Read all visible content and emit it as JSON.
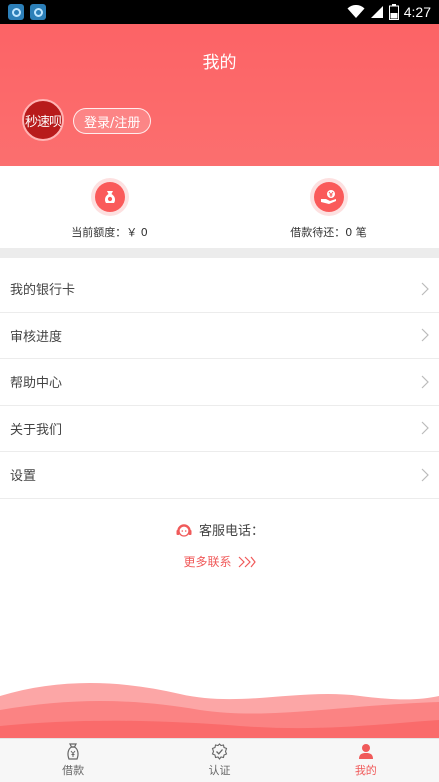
{
  "status_bar": {
    "time": "4:27",
    "battery": "2"
  },
  "header": {
    "title": "我的",
    "avatar_text": "秒速呗",
    "login_label": "登录/注册"
  },
  "stats": [
    {
      "icon": "money-bag-icon",
      "text": "当前额度：￥ 0"
    },
    {
      "icon": "repay-hand-icon",
      "text": "借款待还：0 笔"
    }
  ],
  "menu": [
    {
      "label": "我的银行卡"
    },
    {
      "label": "审核进度"
    },
    {
      "label": "帮助中心"
    },
    {
      "label": "关于我们"
    },
    {
      "label": "设置"
    }
  ],
  "service": {
    "phone_label": "客服电话：",
    "more_label": "更多联系"
  },
  "tabs": [
    {
      "label": "借款",
      "icon": "loan-bag-icon",
      "active": false
    },
    {
      "label": "认证",
      "icon": "verify-icon",
      "active": false
    },
    {
      "label": "我的",
      "icon": "person-icon",
      "active": true
    }
  ],
  "colors": {
    "accent": "#fc6366",
    "accent_text": "#f05a5a",
    "divider": "#ececec"
  }
}
